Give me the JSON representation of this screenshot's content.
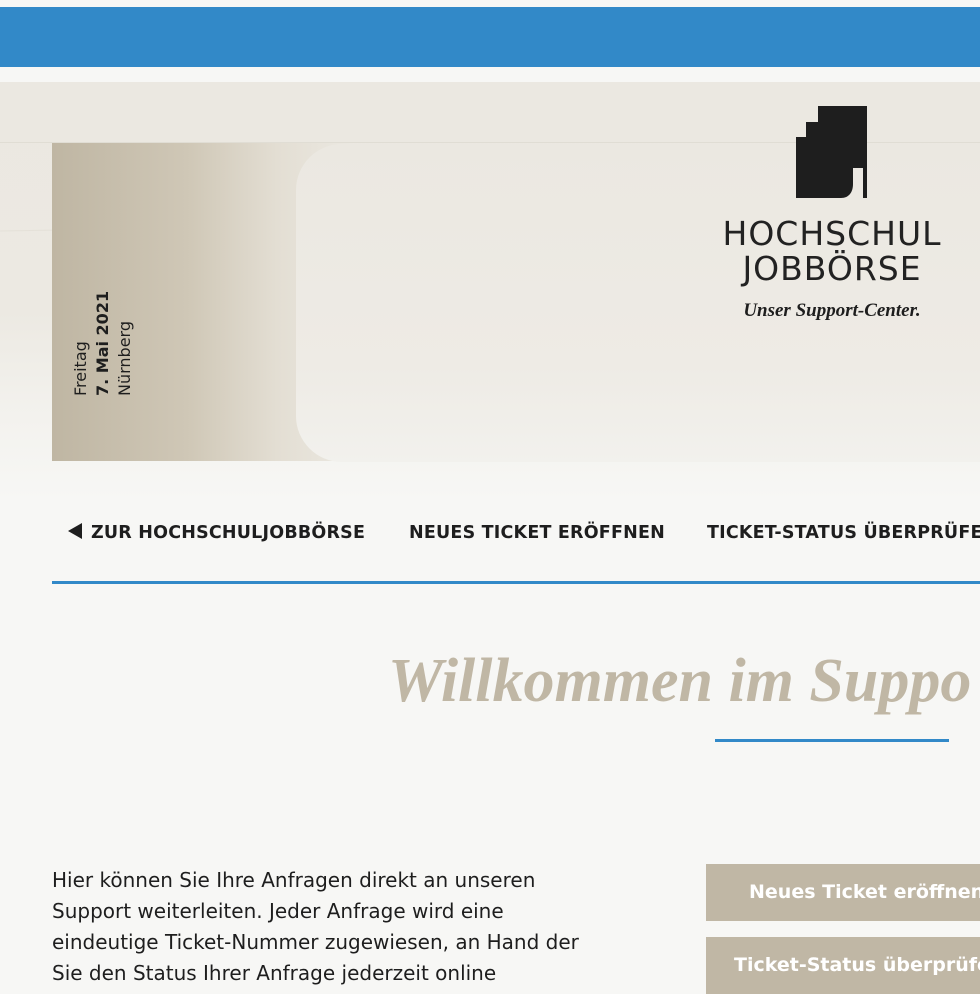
{
  "colors": {
    "accent": "#3289c8",
    "beige": "#c0b7a5",
    "text": "#1e1e1e"
  },
  "event": {
    "weekday": "Freitag",
    "date": "7. Mai 2021",
    "city": "Nürnberg"
  },
  "brand": {
    "line1": "HOCHSCHUL",
    "line2": "JOBBÖRSE",
    "tagline": "Unser Support-Center.",
    "logo_icon": "building-logo-icon"
  },
  "nav": {
    "back": {
      "label": "ZUR HOCHSCHULJOBBÖRSE",
      "icon": "triangle-left-icon"
    },
    "new_ticket": "NEUES TICKET ERÖFFNEN",
    "status": "TICKET-STATUS ÜBERPRÜFEN"
  },
  "welcome": {
    "title": "Willkommen im Suppo"
  },
  "intro": {
    "line1": "Hier können Sie Ihre Anfragen direkt an unseren",
    "line2": "Support weiterleiten. Jeder Anfrage wird eine",
    "line3": "eindeutige Ticket-Nummer zugewiesen, an Hand der",
    "line4": "Sie den Status Ihrer Anfrage jederzeit online"
  },
  "sidebar": {
    "new_ticket_button": "Neues Ticket eröffnen",
    "status_button": "Ticket-Status überprüfen"
  }
}
